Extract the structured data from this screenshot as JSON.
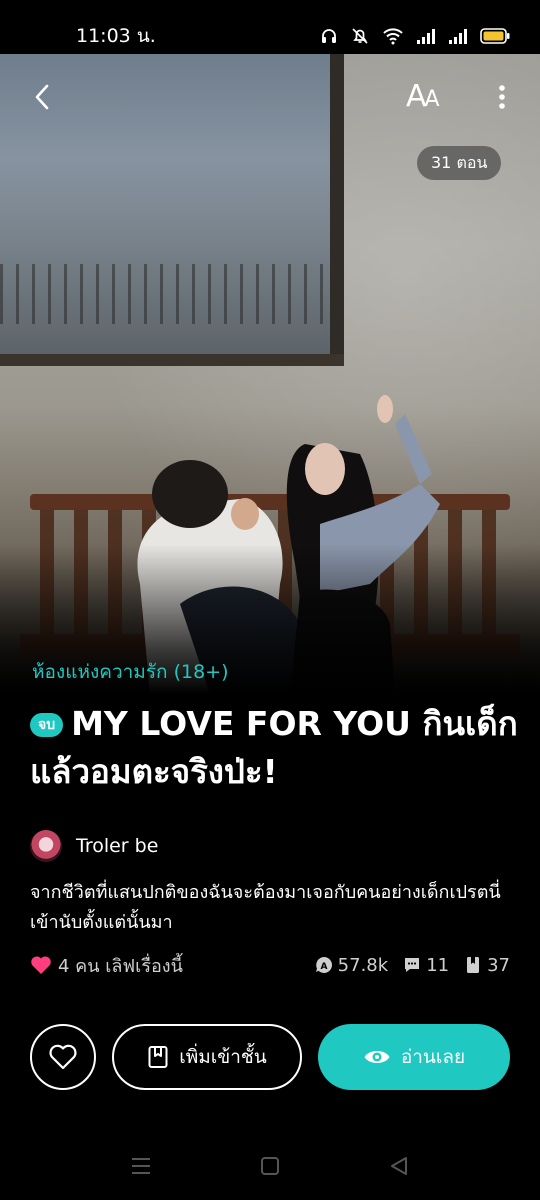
{
  "status_bar": {
    "time": "11:03 น.",
    "icons": [
      "headphones-icon",
      "mute-icon",
      "wifi-icon",
      "signal-icon",
      "signal-icon",
      "battery-icon"
    ],
    "battery_color": "#f4c430"
  },
  "cover": {
    "episodes": "31 ตอน",
    "font_button": {
      "big": "A",
      "small": "A"
    }
  },
  "novel": {
    "category": "ห้องแห่งความรัก  (18+)",
    "status_badge": "จบ",
    "title": "MY LOVE FOR YOU กินเด็กแล้วอมตะจริงป่ะ!",
    "author": "Troler be",
    "description": "จากชีวิตที่แสนปกติของฉันจะต้องมาเจอกับคนอย่างเด็กเปรตนี่เข้านับตั้งแต่นั้นมา",
    "likes_text": "4 คน เลิฟเรื่องนี้",
    "views": "57.8k",
    "comments": "11",
    "chapters": "37"
  },
  "actions": {
    "shelf_label": "เพิ่มเข้าชั้น",
    "read_label": "อ่านเลย"
  },
  "colors": {
    "accent": "#1fc8c0",
    "heart": "#ff3d7f",
    "background": "#000000"
  }
}
